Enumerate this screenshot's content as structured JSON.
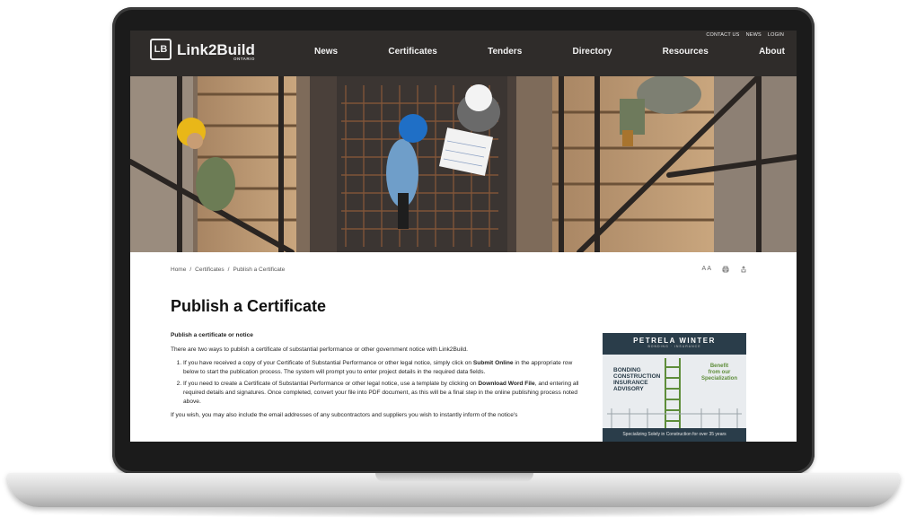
{
  "util_nav": [
    "CONTACT US",
    "NEWS",
    "LOGIN"
  ],
  "logo": {
    "mark": "LB",
    "name": "Link2Build",
    "sub": "ONTARIO"
  },
  "main_nav": [
    "News",
    "Certificates",
    "Tenders",
    "Directory",
    "Resources",
    "About"
  ],
  "breadcrumb": [
    "Home",
    "/",
    "Certificates",
    "/",
    "Publish a Certificate"
  ],
  "tools": {
    "text_size": "A A",
    "print_icon": "print-icon",
    "share_icon": "share-icon"
  },
  "page": {
    "title": "Publish a Certificate",
    "subhead": "Publish a certificate or notice",
    "intro": "There are two ways to publish a certificate of substantial performance or other government notice with Link2Build.",
    "item1_a": "If you have received a copy of your Certificate of Substantial Performance or other legal notice, simply click on ",
    "item1_b": "Submit Online",
    "item1_c": " in the appropriate row below to start the publication process. The system will prompt you to enter project details in the required data fields.",
    "item2_a": "If you need to create a Certificate of Substantial Performance or other legal notice, use a template by clicking on ",
    "item2_b": "Download Word File",
    "item2_c": ", and entering all required details and signatures. Once completed, convert your file into PDF document, as this will be a final step in the online publishing process noted above.",
    "outro": "If you wish, you may also include the email addresses of any subcontractors and suppliers you wish to instantly inform of the notice's"
  },
  "ad": {
    "brand": "PETRELA WINTER",
    "brand_sub": "BONDING · INSURANCE",
    "left_lines": [
      "BONDING",
      "CONSTRUCTION",
      "INSURANCE",
      "ADVISORY"
    ],
    "right_lines": [
      "Benefit",
      "from our",
      "Specialization"
    ],
    "footer": "Specializing Solely in Construction for over 35 years"
  }
}
